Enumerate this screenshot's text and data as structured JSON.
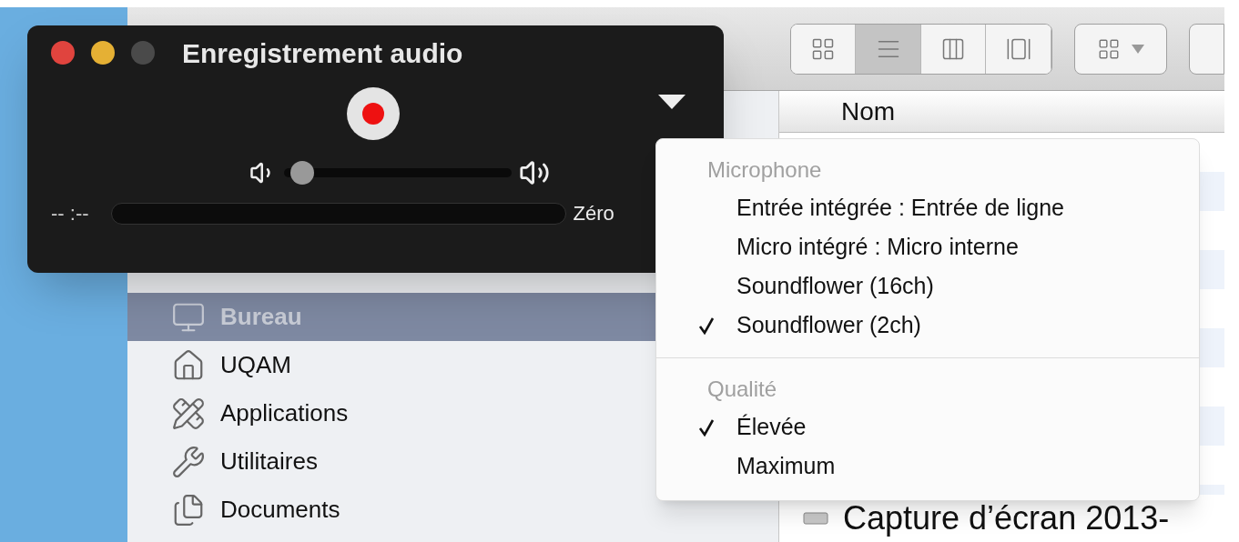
{
  "finder": {
    "toolbar": {
      "view_modes": [
        {
          "kind": "icons",
          "selected": false
        },
        {
          "kind": "list",
          "selected": true
        },
        {
          "kind": "columns",
          "selected": false
        },
        {
          "kind": "coverflow",
          "selected": false
        }
      ]
    },
    "sidebar": {
      "items": [
        {
          "kind": "desktop",
          "label": "Bureau",
          "selected": true
        },
        {
          "kind": "home",
          "label": "UQAM",
          "selected": false
        },
        {
          "kind": "apps",
          "label": "Applications",
          "selected": false
        },
        {
          "kind": "utilities",
          "label": "Utilitaires",
          "selected": false
        },
        {
          "kind": "documents",
          "label": "Documents",
          "selected": false
        }
      ]
    },
    "file_list": {
      "columns": [
        "Nom"
      ],
      "rows": [
        {
          "name": "Capture d’écran 2013-"
        }
      ]
    }
  },
  "recorder": {
    "title": "Enregistrement audio",
    "volume": {
      "level": 0.03
    },
    "elapsed": "-- :--",
    "file_size": "Zéro"
  },
  "menu": {
    "sections": [
      {
        "header": "Microphone",
        "items": [
          {
            "label": "Entrée intégrée : Entrée de ligne",
            "checked": false
          },
          {
            "label": "Micro intégré : Micro interne",
            "checked": false
          },
          {
            "label": "Soundflower (16ch)",
            "checked": false
          },
          {
            "label": "Soundflower (2ch)",
            "checked": true
          }
        ]
      },
      {
        "header": "Qualité",
        "items": [
          {
            "label": "Élevée",
            "checked": true
          },
          {
            "label": "Maximum",
            "checked": false
          }
        ]
      }
    ]
  }
}
